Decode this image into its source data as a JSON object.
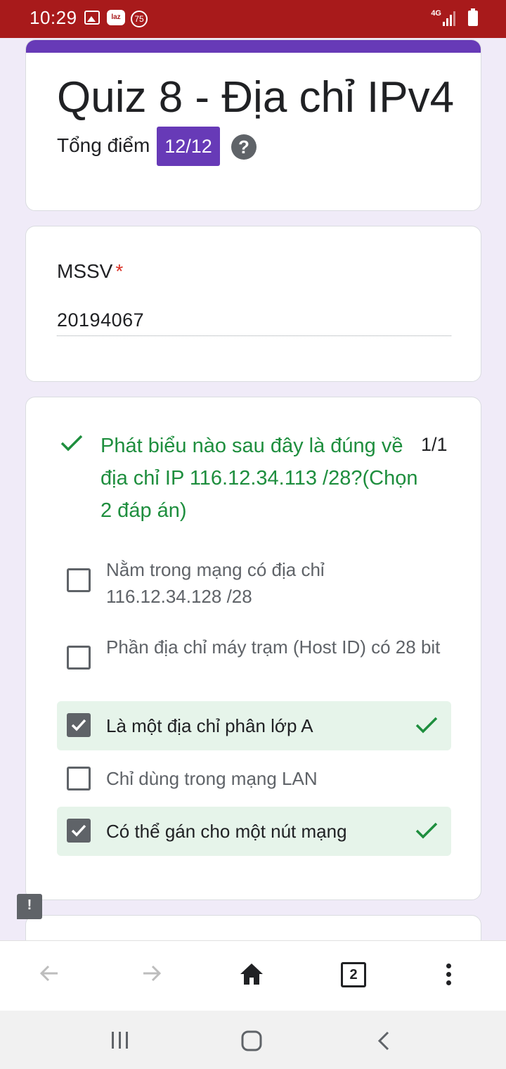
{
  "status_bar": {
    "time": "10:29",
    "notification_badge": "75",
    "app_icon_text": "laz",
    "network": "4G"
  },
  "header": {
    "title": "Quiz 8 - Địa chỉ IPv4",
    "score_label": "Tổng điểm",
    "score_value": "12/12",
    "help_symbol": "?"
  },
  "mssv": {
    "label": "MSSV",
    "required_mark": "*",
    "value": "20194067"
  },
  "question": {
    "text": "Phát biểu nào sau đây là đúng về địa chỉ IP 116.12.34.113 /28?(Chọn 2 đáp án)",
    "points": "1/1",
    "options": [
      {
        "label": "Nằm trong mạng có địa chỉ 116.12.34.128 /28",
        "checked": false,
        "correct": false
      },
      {
        "label": "Phần địa chỉ máy trạm (Host ID) có 28 bit",
        "checked": false,
        "correct": false
      },
      {
        "label": "Là một địa chỉ phân lớp A",
        "checked": true,
        "correct": true
      },
      {
        "label": "Chỉ dùng trong mạng LAN",
        "checked": false,
        "correct": false
      },
      {
        "label": "Có thể gán cho một nút mạng",
        "checked": true,
        "correct": true
      }
    ]
  },
  "feedback_symbol": "!",
  "browser_toolbar": {
    "tab_count": "2",
    "icons": [
      "back-arrow-icon",
      "forward-arrow-icon",
      "home-icon",
      "tabs-icon",
      "more-vert-icon"
    ]
  },
  "system_nav": {
    "icons": [
      "recents-icon",
      "home-button-icon",
      "back-icon"
    ]
  },
  "colors": {
    "status_bar": "#a81a1b",
    "accent": "#673ab7",
    "correct": "#1e8e3e",
    "correct_bg": "#e6f4ea",
    "page_bg": "#f0ebf8"
  }
}
